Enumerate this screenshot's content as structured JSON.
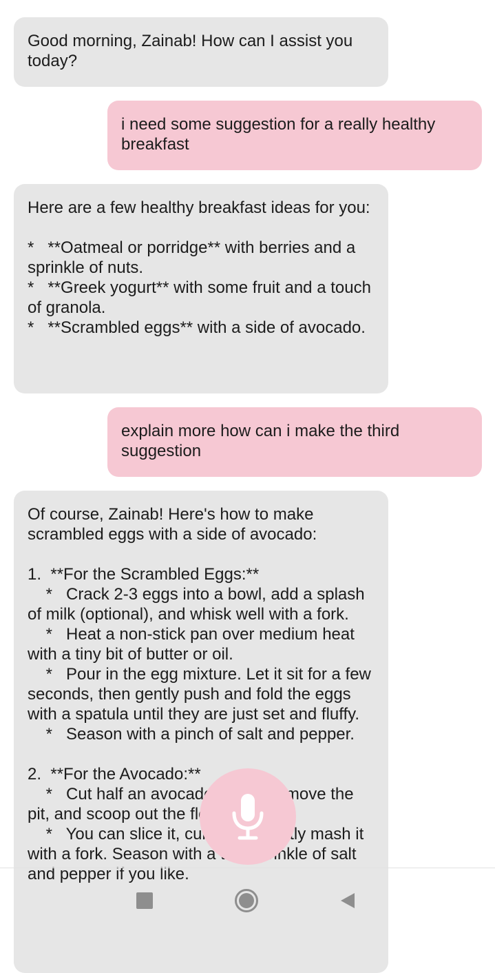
{
  "conversation": {
    "messages": [
      {
        "role": "assistant",
        "text": "Good morning, Zainab! How can I assist you today?"
      },
      {
        "role": "user",
        "text": "i need some suggestion for a really healthy breakfast"
      },
      {
        "role": "assistant",
        "text": "Here are a few healthy breakfast ideas for you:\n\n*   **Oatmeal or porridge** with berries and a sprinkle of nuts.\n*   **Greek yogurt** with some fruit and a touch of granola.\n*   **Scrambled eggs** with a side of avocado."
      },
      {
        "role": "user",
        "text": "explain more how can i make the third suggestion"
      },
      {
        "role": "assistant",
        "text": "Of course, Zainab! Here's how to make scrambled eggs with a side of avocado:\n\n1.  **For the Scrambled Eggs:**\n    *   Crack 2-3 eggs into a bowl, add a splash of milk (optional), and whisk well with a fork.\n    *   Heat a non-stick pan over medium heat with a tiny bit of butter or oil.\n    *   Pour in the egg mixture. Let it sit for a few seconds, then gently push and fold the eggs with a spatula until they are just set and fluffy.\n    *   Season with a pinch of salt and pepper.\n\n2.  **For the Avocado:**\n    *   Cut half an avocado in half, remove the pit, and scoop out the flesh.\n    *   You can slice it, cube it, or gently mash it with a fork. Season with a tiny sprinkle of salt and pepper if you like."
      }
    ]
  },
  "mic_button": {
    "icon": "microphone-icon"
  },
  "navigation_bar": {
    "buttons": [
      {
        "icon": "recents-square-icon"
      },
      {
        "icon": "home-circle-icon"
      },
      {
        "icon": "back-triangle-icon"
      }
    ]
  },
  "colors": {
    "assistant_bubble": "#e6e6e6",
    "user_bubble": "#f6c8d3",
    "mic_fab": "#f6c8d3",
    "nav_icon": "#8e8e8e"
  }
}
